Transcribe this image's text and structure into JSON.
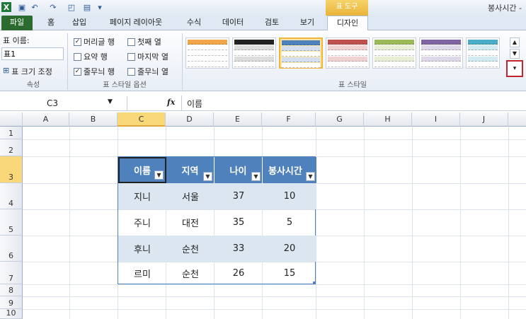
{
  "titlebar": {
    "doc_title": "봉사시간 -",
    "context_header": "표 도구"
  },
  "tabs": [
    {
      "label": "파일"
    },
    {
      "label": "홈"
    },
    {
      "label": "삽입"
    },
    {
      "label": "페이지 레이아웃"
    },
    {
      "label": "수식"
    },
    {
      "label": "데이터"
    },
    {
      "label": "검토"
    },
    {
      "label": "보기"
    },
    {
      "label": "디자인"
    }
  ],
  "ribbon": {
    "properties": {
      "name_label": "표 이름:",
      "name_value": "표1",
      "resize_label": "표 크기 조정",
      "group_label": "속성"
    },
    "style_options": {
      "group_label": "표 스타일 옵션",
      "options": [
        {
          "label": "머리글 행",
          "checked": true
        },
        {
          "label": "첫째 열",
          "checked": false
        },
        {
          "label": "요약 행",
          "checked": false
        },
        {
          "label": "마지막 열",
          "checked": false
        },
        {
          "label": "줄무늬 행",
          "checked": true
        },
        {
          "label": "줄무늬 열",
          "checked": false
        }
      ]
    },
    "styles": {
      "group_label": "표 스타일",
      "swatches": [
        {
          "color": "#f2a649"
        },
        {
          "color": "#222222"
        },
        {
          "color": "#4f81bd"
        },
        {
          "color": "#c0504d"
        },
        {
          "color": "#9bbb59"
        },
        {
          "color": "#8064a2"
        },
        {
          "color": "#4bacc6"
        }
      ]
    }
  },
  "formula": {
    "name_box": "C3",
    "fx": "fx",
    "content": "이름"
  },
  "columns": [
    "A",
    "B",
    "C",
    "D",
    "E",
    "F",
    "G",
    "H",
    "I",
    "J"
  ],
  "rows": [
    "1",
    "2",
    "3",
    "4",
    "5",
    "6",
    "7",
    "8",
    "9",
    "10"
  ],
  "table": {
    "headers": [
      "이름",
      "지역",
      "나이",
      "봉사시간"
    ],
    "rows": [
      [
        "지니",
        "서울",
        "37",
        "10"
      ],
      [
        "주니",
        "대전",
        "35",
        "5"
      ],
      [
        "후니",
        "순천",
        "33",
        "20"
      ],
      [
        "르미",
        "순천",
        "26",
        "15"
      ]
    ]
  }
}
